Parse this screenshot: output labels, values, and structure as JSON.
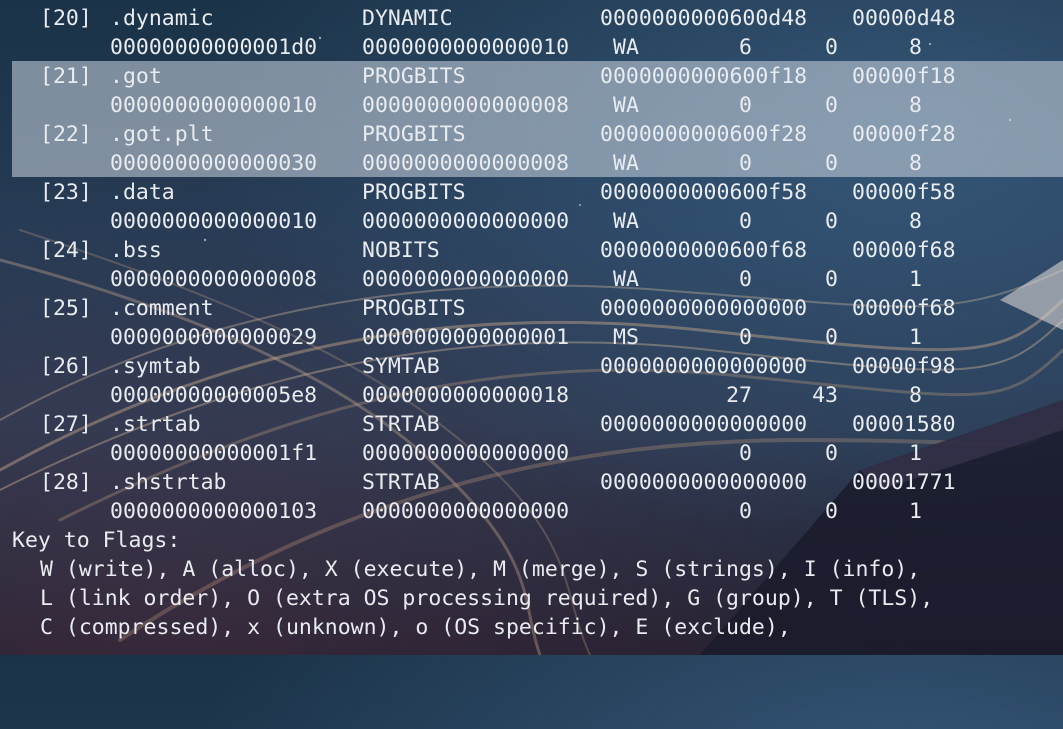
{
  "sections": [
    {
      "idx": "[20]",
      "name": ".dynamic",
      "type": "DYNAMIC",
      "address": "0000000000600d48",
      "offset": "00000d48",
      "size": "00000000000001d0",
      "entsize": "0000000000000010",
      "flags": "WA",
      "link": "6",
      "info": "0",
      "align": "8"
    },
    {
      "idx": "[21]",
      "name": ".got",
      "type": "PROGBITS",
      "address": "0000000000600f18",
      "offset": "00000f18",
      "size": "0000000000000010",
      "entsize": "0000000000000008",
      "flags": "WA",
      "link": "0",
      "info": "0",
      "align": "8"
    },
    {
      "idx": "[22]",
      "name": ".got.plt",
      "type": "PROGBITS",
      "address": "0000000000600f28",
      "offset": "00000f28",
      "size": "0000000000000030",
      "entsize": "0000000000000008",
      "flags": "WA",
      "link": "0",
      "info": "0",
      "align": "8"
    },
    {
      "idx": "[23]",
      "name": ".data",
      "type": "PROGBITS",
      "address": "0000000000600f58",
      "offset": "00000f58",
      "size": "0000000000000010",
      "entsize": "0000000000000000",
      "flags": "WA",
      "link": "0",
      "info": "0",
      "align": "8"
    },
    {
      "idx": "[24]",
      "name": ".bss",
      "type": "NOBITS",
      "address": "0000000000600f68",
      "offset": "00000f68",
      "size": "0000000000000008",
      "entsize": "0000000000000000",
      "flags": "WA",
      "link": "0",
      "info": "0",
      "align": "1"
    },
    {
      "idx": "[25]",
      "name": ".comment",
      "type": "PROGBITS",
      "address": "0000000000000000",
      "offset": "00000f68",
      "size": "0000000000000029",
      "entsize": "0000000000000001",
      "flags": "MS",
      "link": "0",
      "info": "0",
      "align": "1"
    },
    {
      "idx": "[26]",
      "name": ".symtab",
      "type": "SYMTAB",
      "address": "0000000000000000",
      "offset": "00000f98",
      "size": "00000000000005e8",
      "entsize": "0000000000000018",
      "flags": "",
      "link": "27",
      "info": "43",
      "align": "8"
    },
    {
      "idx": "[27]",
      "name": ".strtab",
      "type": "STRTAB",
      "address": "0000000000000000",
      "offset": "00001580",
      "size": "00000000000001f1",
      "entsize": "0000000000000000",
      "flags": "",
      "link": "0",
      "info": "0",
      "align": "1"
    },
    {
      "idx": "[28]",
      "name": ".shstrtab",
      "type": "STRTAB",
      "address": "0000000000000000",
      "offset": "00001771",
      "size": "0000000000000103",
      "entsize": "0000000000000000",
      "flags": "",
      "link": "0",
      "info": "0",
      "align": "1"
    }
  ],
  "legend": {
    "title": "Key to Flags:",
    "lines": [
      "W (write), A (alloc), X (execute), M (merge), S (strings), I (info),",
      "L (link order), O (extra OS processing required), G (group), T (TLS),",
      "C (compressed), x (unknown), o (OS specific), E (exclude),"
    ]
  },
  "colors": {
    "text": "#e8ebef",
    "selection": "#cdd7e1",
    "background": "#233b55"
  }
}
